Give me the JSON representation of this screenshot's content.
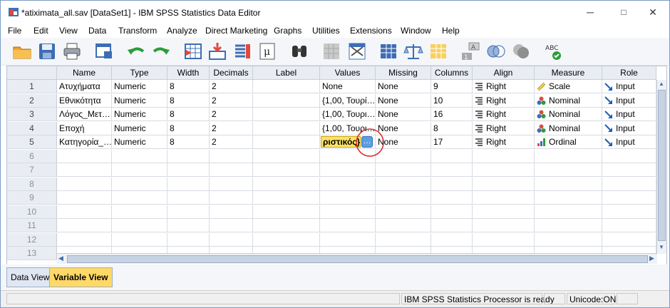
{
  "window": {
    "title": "*atiximata_all.sav [DataSet1] - IBM SPSS Statistics Data Editor",
    "minimize": "─",
    "maximize": "□",
    "close": "✕"
  },
  "menu": [
    "File",
    "Edit",
    "View",
    "Data",
    "Transform",
    "Analyze",
    "Direct Marketing",
    "Graphs",
    "Utilities",
    "Extensions",
    "Window",
    "Help"
  ],
  "toolbar": {
    "icons": [
      "open-folder-icon",
      "save-icon",
      "print-icon",
      "dialog-recall-icon",
      "undo-icon",
      "redo-icon",
      "goto-case-icon",
      "goto-variable-icon",
      "variables-icon",
      "run-descriptives-icon",
      "find-icon",
      "insert-cases-icon",
      "insert-variable-icon",
      "split-file-icon",
      "weight-cases-icon",
      "select-cases-icon",
      "value-labels-icon",
      "use-sets-icon",
      "show-all-variables-icon",
      "spell-check-icon"
    ],
    "spell_label": "ABC"
  },
  "grid": {
    "columns": [
      "Name",
      "Type",
      "Width",
      "Decimals",
      "Label",
      "Values",
      "Missing",
      "Columns",
      "Align",
      "Measure",
      "Role"
    ],
    "rows": [
      {
        "num": "1",
        "name": "Ατυχήματα",
        "type": "Numeric",
        "width": "8",
        "decimals": "2",
        "label": "",
        "values": "None",
        "missing": "None",
        "columns": "9",
        "align": "Right",
        "measure": "Scale",
        "role": "Input"
      },
      {
        "num": "2",
        "name": "Εθνικότητα",
        "type": "Numeric",
        "width": "8",
        "decimals": "2",
        "label": "",
        "values": "{1,00, Τουρί…",
        "missing": "None",
        "columns": "10",
        "align": "Right",
        "measure": "Nominal",
        "role": "Input"
      },
      {
        "num": "3",
        "name": "Λόγος_Μετ…",
        "type": "Numeric",
        "width": "8",
        "decimals": "2",
        "label": "",
        "values": "{1,00, Τουρι…",
        "missing": "None",
        "columns": "16",
        "align": "Right",
        "measure": "Nominal",
        "role": "Input"
      },
      {
        "num": "4",
        "name": "Εποχή",
        "type": "Numeric",
        "width": "8",
        "decimals": "2",
        "label": "",
        "values": "{1,00, Τουρι…",
        "missing": "None",
        "columns": "8",
        "align": "Right",
        "measure": "Nominal",
        "role": "Input"
      },
      {
        "num": "5",
        "name": "Κατηγορία_…",
        "type": "Numeric",
        "width": "8",
        "decimals": "2",
        "label": "",
        "values": "ριστικός}…",
        "missing": "None",
        "columns": "17",
        "align": "Right",
        "measure": "Ordinal",
        "role": "Input"
      }
    ],
    "empty_rows": [
      "6",
      "7",
      "8",
      "9",
      "10",
      "11",
      "12",
      "13"
    ],
    "ellipsis_button": "…"
  },
  "tabs": {
    "data_view": "Data View",
    "variable_view": "Variable View"
  },
  "status": {
    "processor": "IBM SPSS Statistics Processor is ready",
    "encoding": "Unicode:ON"
  },
  "colors": {
    "selected_tab": "#ffd966",
    "edit_cell": "#fbe26b",
    "highlight_circle": "#d62b2b"
  }
}
